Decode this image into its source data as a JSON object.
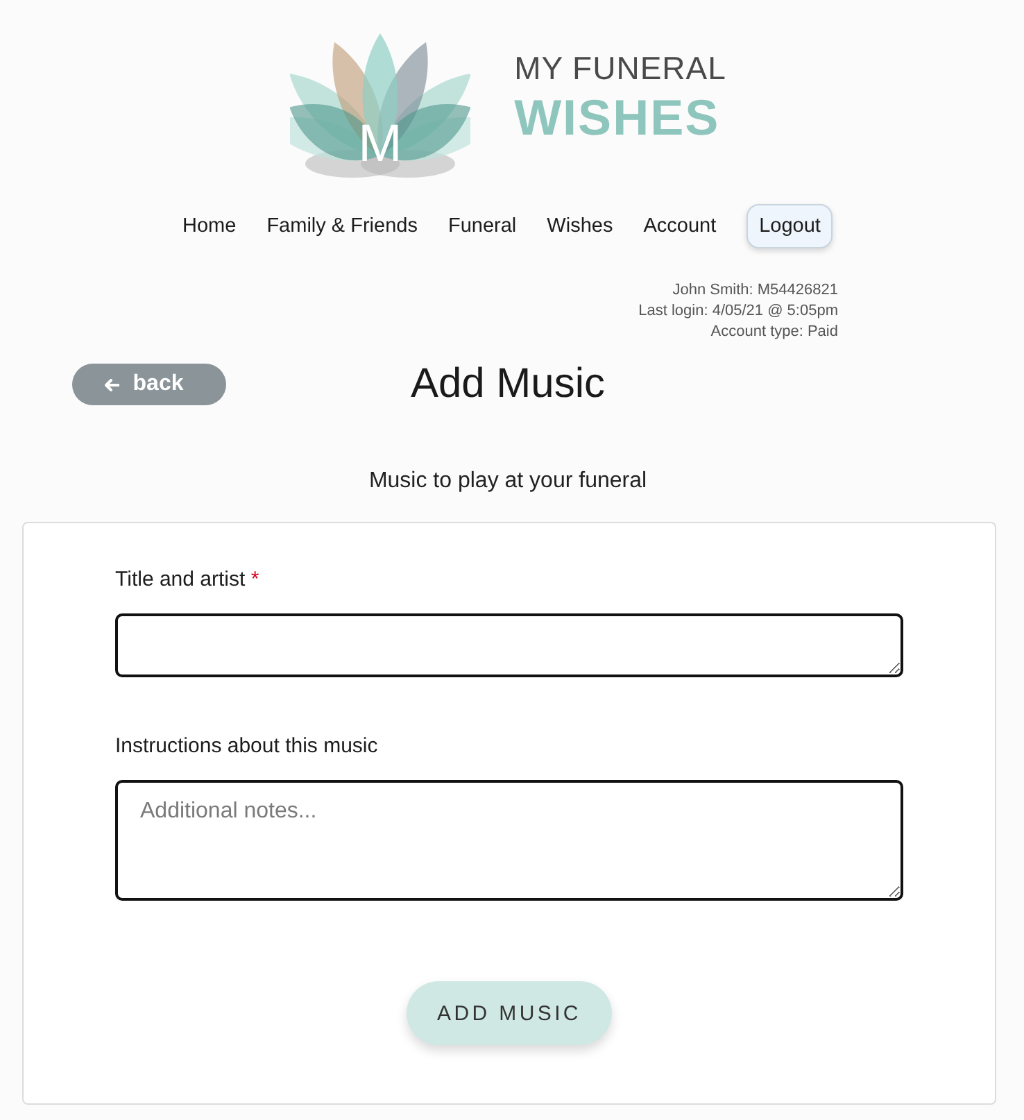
{
  "logo": {
    "monogram": "M",
    "line_1": "MY FUNERAL",
    "line_2": "WISHES"
  },
  "nav": {
    "items": [
      {
        "label": "Home"
      },
      {
        "label": "Family & Friends"
      },
      {
        "label": "Funeral"
      },
      {
        "label": "Wishes"
      },
      {
        "label": "Account"
      }
    ],
    "logout": "Logout"
  },
  "user_info": [
    "John Smith: M54426821",
    "Last login: 4/05/21 @ 5:05pm",
    "Account type: Paid"
  ],
  "back_button": {
    "label": "back"
  },
  "page_title": "Add Music",
  "subtitle": "Music to play at your funeral",
  "form": {
    "fields": [
      {
        "label": "Title and artist",
        "required_mark": "*"
      },
      {
        "label": "Instructions about this music",
        "placeholder": "Additional notes..."
      }
    ],
    "submit": "ADD MUSIC"
  }
}
